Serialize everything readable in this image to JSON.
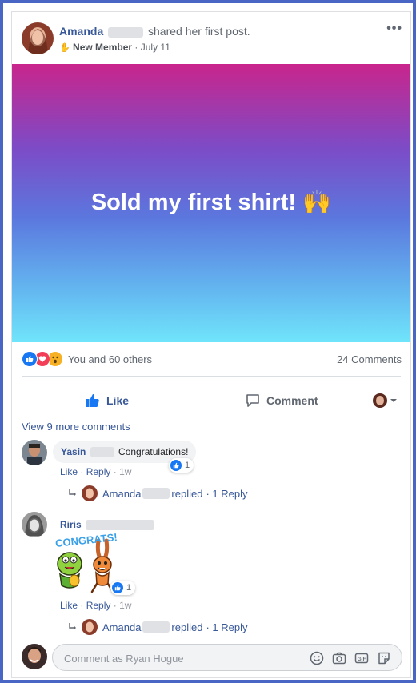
{
  "post": {
    "author_name": "Amanda",
    "action_text": "shared her first post.",
    "badge": "New Member",
    "date": "· July 11",
    "banner_text": "Sold my first shirt! 🙌",
    "more_icon": "•••"
  },
  "stats": {
    "reactions": [
      "like-icon",
      "love-icon",
      "wow-icon"
    ],
    "reactions_text": "You and 60 others",
    "comments_count": "24 Comments"
  },
  "actions": {
    "like_label": "Like",
    "comment_label": "Comment"
  },
  "comments": {
    "view_more": "View 9 more comments",
    "items": [
      {
        "name": "Yasin",
        "text": "Congratulations!",
        "like": "Like",
        "reply": "Reply",
        "time": "1w",
        "reaction_count": "1",
        "reply_author": "Amanda",
        "reply_text": "replied",
        "reply_count": "· 1 Reply"
      },
      {
        "name": "Riris",
        "sticker_text": "CONGRATS!",
        "like": "Like",
        "reply": "Reply",
        "time": "1w",
        "reaction_count": "1",
        "reply_author": "Amanda",
        "reply_text": "replied",
        "reply_count": "· 1 Reply"
      }
    ]
  },
  "composer": {
    "placeholder": "Comment as Ryan Hogue",
    "icons": [
      "emoji-icon",
      "camera-icon",
      "gif-icon",
      "sticker-icon"
    ]
  },
  "colors": {
    "accent": "#385898",
    "like_blue": "#1877f2",
    "love_red": "#f33e58",
    "wow_yellow": "#f7b125"
  }
}
